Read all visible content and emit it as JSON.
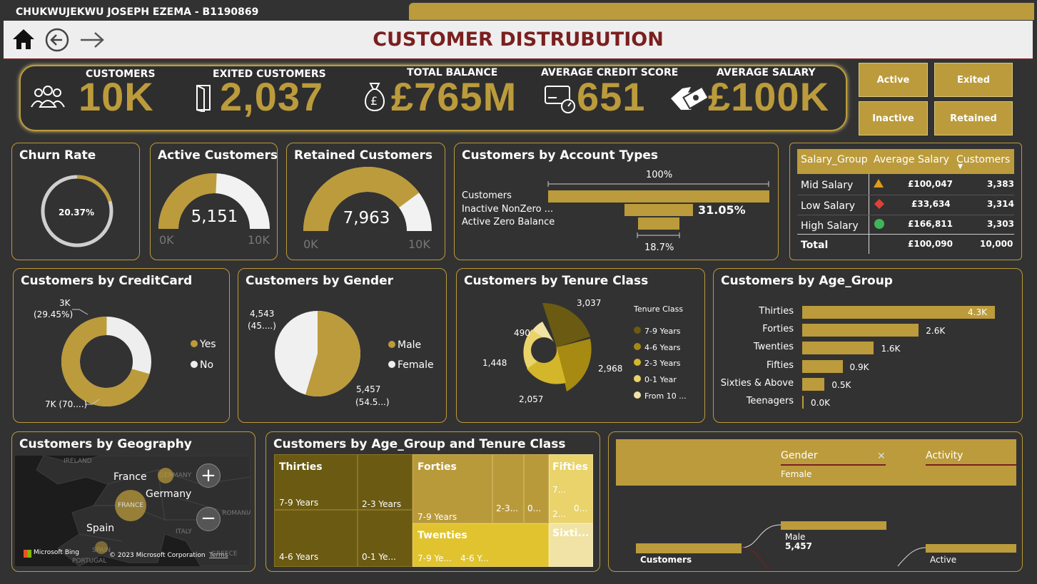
{
  "header": {
    "owner": "CHUKWUJEKWU JOSEPH EZEMA - B1190869",
    "title": "CUSTOMER DISTRUBUTION"
  },
  "kpis": [
    {
      "label": "CUSTOMERS",
      "value": "10K",
      "icon": "people-icon"
    },
    {
      "label": "EXITED CUSTOMERS",
      "value": "2,037",
      "icon": "door-exit-icon"
    },
    {
      "label": "TOTAL BALANCE",
      "value": "£765M",
      "icon": "money-bag-icon"
    },
    {
      "label": "AVERAGE CREDIT SCORE",
      "value": "651",
      "icon": "credit-card-icon"
    },
    {
      "label": "AVERAGE SALARY",
      "value": "£100K",
      "icon": "cash-hand-icon"
    }
  ],
  "buttons": {
    "active": "Active",
    "exited": "Exited",
    "inactive": "Inactive",
    "retained": "Retained"
  },
  "churn": {
    "title": "Churn Rate",
    "label": "20.37%",
    "rate": 0.2037
  },
  "active_gauge": {
    "title": "Active Customers",
    "value": "5,151",
    "min": "0K",
    "max": "10K",
    "fraction": 0.5151
  },
  "retained_gauge": {
    "title": "Retained Customers",
    "value": "7,963",
    "min": "0K",
    "max": "10K",
    "fraction": 0.7963
  },
  "account_types": {
    "title": "Customers by Account Types",
    "top_label": "100%",
    "bars": [
      {
        "label": "Customers",
        "fraction": 1.0
      },
      {
        "label": "Inactive NonZero ...",
        "fraction": 0.3105,
        "value": "31.05%"
      },
      {
        "label": "Active Zero Balance",
        "fraction": 0.187
      }
    ],
    "bottom_label": "18.7%"
  },
  "salary_table": {
    "headers": [
      "Salary_Group",
      "Average Salary",
      "Customers"
    ],
    "rows": [
      {
        "group": "Mid Salary",
        "icon": "triangle-icon",
        "color": "#e09b1a",
        "avg": "£100,047",
        "customers": "3,383"
      },
      {
        "group": "Low Salary",
        "icon": "diamond-icon",
        "color": "#e0403a",
        "avg": "£33,634",
        "customers": "3,314"
      },
      {
        "group": "High Salary",
        "icon": "circle-icon",
        "color": "#3fb45a",
        "avg": "£166,811",
        "customers": "3,303"
      }
    ],
    "total": {
      "group": "Total",
      "avg": "£100,090",
      "customers": "10,000"
    }
  },
  "creditcard": {
    "title": "Customers by CreditCard",
    "top_label_1": "3K",
    "top_label_2": "(29.45%)",
    "bottom_label": "7K (70....)",
    "legend": [
      "Yes",
      "No"
    ],
    "yes_share": 0.7055
  },
  "gender": {
    "title": "Customers by Gender",
    "female_label_1": "4,543",
    "female_label_2": "(45....)",
    "male_label_1": "5,457",
    "male_label_2": "(54.5...)",
    "legend": [
      "Male",
      "Female"
    ],
    "male_share": 0.5457
  },
  "tenure": {
    "title": "Customers by Tenure Class",
    "legend_title": "Tenure Class",
    "legend": [
      "7-9 Years",
      "4-6 Years",
      "2-3 Years",
      "0-1 Year",
      "From 10 ..."
    ],
    "labels": [
      "3,037",
      "2,968",
      "2,057",
      "1,448",
      "490"
    ]
  },
  "age": {
    "title": "Customers by Age_Group",
    "bars": [
      {
        "label": "Thirties",
        "value": 4300,
        "text": "4.3K"
      },
      {
        "label": "Forties",
        "value": 2600,
        "text": "2.6K"
      },
      {
        "label": "Twenties",
        "value": 1600,
        "text": "1.6K"
      },
      {
        "label": "Fifties",
        "value": 900,
        "text": "0.9K"
      },
      {
        "label": "Sixties & Above",
        "value": 500,
        "text": "0.5K"
      },
      {
        "label": "Teenagers",
        "value": 20,
        "text": "0.0K"
      }
    ]
  },
  "geo": {
    "title": "Customers by Geography",
    "countries": [
      "France",
      "Germany",
      "Spain"
    ],
    "map_labels": [
      "IRELAND",
      "GERMANY",
      "FRANCE",
      "ROMANIA",
      "ITALY",
      "SPAIN",
      "PORTUGAL",
      "GREECE"
    ],
    "bing": "Microsoft Bing",
    "copyright": "© 2023 Microsoft Corporation",
    "terms": "Terms"
  },
  "treemap": {
    "title": "Customers by Age_Group and Tenure Class",
    "cells": {
      "thirties": "Thirties",
      "t79": "7-9 Years",
      "t23": "2-3 Years",
      "t46": "4-6 Years",
      "t01": "0-1 Ye...",
      "forties": "Forties",
      "f79": "7-9 Years",
      "f23": "2-3...",
      "f0": "0...",
      "fifties": "Fifties",
      "fi7": "7...",
      "fi2": "2...",
      "fi0": "0...",
      "twenties": "Twenties",
      "tw79": "7-9 Ye...",
      "tw46": "4-6 Y...",
      "sixties": "Sixti..."
    }
  },
  "decomp": {
    "gender_header": "Gender",
    "activity_header": "Activity",
    "gender_value": "Female",
    "root": "Customers",
    "male": "Male",
    "male_value": "5,457",
    "active": "Active"
  }
}
